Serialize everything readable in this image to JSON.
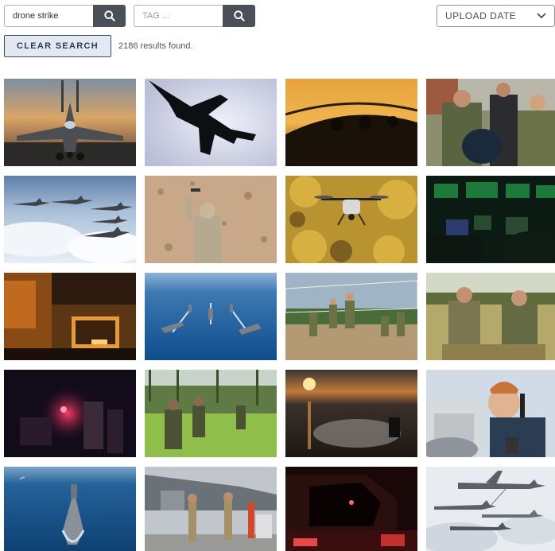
{
  "search": {
    "query": "drone strike",
    "tag_placeholder": "TAG ..."
  },
  "sort": {
    "selected": "UPLOAD DATE"
  },
  "clear_button": "CLEAR SEARCH",
  "results_text": "2186 results found.",
  "icons": {
    "search": "search-icon",
    "dropdown": "chevron-down-icon"
  },
  "colors": {
    "search_button": "#4a5058",
    "clear_button_bg": "#e3e9f3",
    "clear_button_text": "#2d3b53"
  },
  "thumbnails": [
    {
      "subject": "fighter-jet-runway-sunset"
    },
    {
      "subject": "jet-silhouette-sky"
    },
    {
      "subject": "cockpit-sunset"
    },
    {
      "subject": "soldiers-medical-training"
    },
    {
      "subject": "jets-formation-clouds"
    },
    {
      "subject": "soldier-desert-drone"
    },
    {
      "subject": "quadcopter-drone-autumn"
    },
    {
      "subject": "cockpit-green-night"
    },
    {
      "subject": "ship-hangar-night"
    },
    {
      "subject": "ships-formation-ocean"
    },
    {
      "subject": "volleyball-game"
    },
    {
      "subject": "soldiers-field-resting"
    },
    {
      "subject": "night-red-lights"
    },
    {
      "subject": "soldiers-tall-grass"
    },
    {
      "subject": "sunset-ocean-landing-craft"
    },
    {
      "subject": "sailor-binoculars"
    },
    {
      "subject": "warship-ocean"
    },
    {
      "subject": "jet-maintenance-crew"
    },
    {
      "subject": "red-lit-cockpit"
    },
    {
      "subject": "aerial-refueling-formation"
    }
  ]
}
